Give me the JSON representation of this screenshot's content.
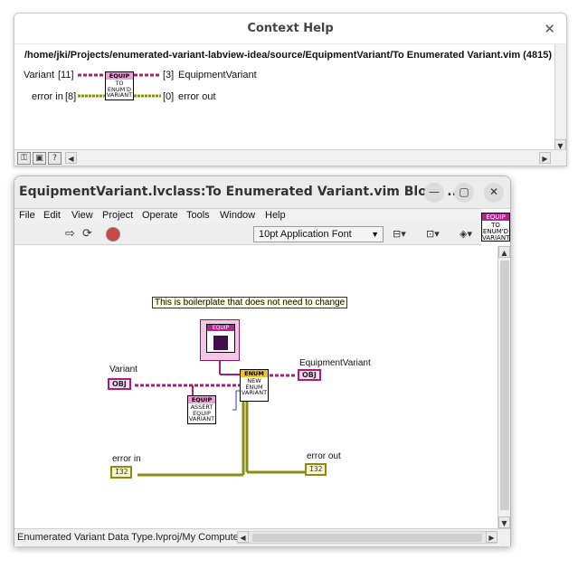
{
  "context_help": {
    "title": "Context Help",
    "close_glyph": "✕",
    "path": "/home/jki/Projects/enumerated-variant-labview-idea/source/EquipmentVariant/To Enumerated Variant.vim (4815)",
    "inputs": [
      {
        "label": "Variant",
        "index": "[11]"
      },
      {
        "label": "error in",
        "index": "[8]"
      }
    ],
    "outputs": [
      {
        "index": "[3]",
        "label": "EquipmentVariant"
      },
      {
        "index": "[0]",
        "label": "error out"
      }
    ],
    "node_icon": {
      "header": "EQUIP",
      "lines": [
        "TO",
        "ENUM'D",
        "VARIANT"
      ]
    }
  },
  "block_diagram": {
    "title": "EquipmentVariant.lvclass:To Enumerated Variant.vim Block ...",
    "window_buttons": {
      "minimize": "—",
      "maximize": "▢",
      "close": "✕"
    },
    "menu": [
      "File",
      "Edit",
      "View",
      "Project",
      "Operate",
      "Tools",
      "Window",
      "Help"
    ],
    "font_select": "10pt Application Font",
    "vi_icon": {
      "header": "EQUIP",
      "lines": [
        "TO",
        "ENUM'D",
        "VARIANT"
      ]
    },
    "free_label": "This is boilerplate that does not need to change",
    "labels": {
      "variant": "Variant",
      "equipment_variant": "EquipmentVariant",
      "error_in": "error in",
      "error_out": "error out"
    },
    "terminals": {
      "variant": "OBJ",
      "equipment_variant": "OBJ",
      "error_in": "I32",
      "error_out": "I32"
    },
    "subvi_new_enum": {
      "header": "ENUM",
      "lines": [
        "NEW",
        "ENUM",
        "VARIANT"
      ]
    },
    "subvi_assert": {
      "header": "EQUIP",
      "lines": [
        "ASSERT",
        "EQUIP",
        "VARIANT"
      ]
    },
    "constant_header": "EQUIP",
    "status": "Enumerated Variant Data Type.lvproj/My Computer"
  },
  "colors": {
    "class_wire": "#a81f75",
    "error_wire": "#8c8c14",
    "blue_wire": "#2a3fa0",
    "enum_header": "#f0c020",
    "equip_header": "#b0258f"
  }
}
